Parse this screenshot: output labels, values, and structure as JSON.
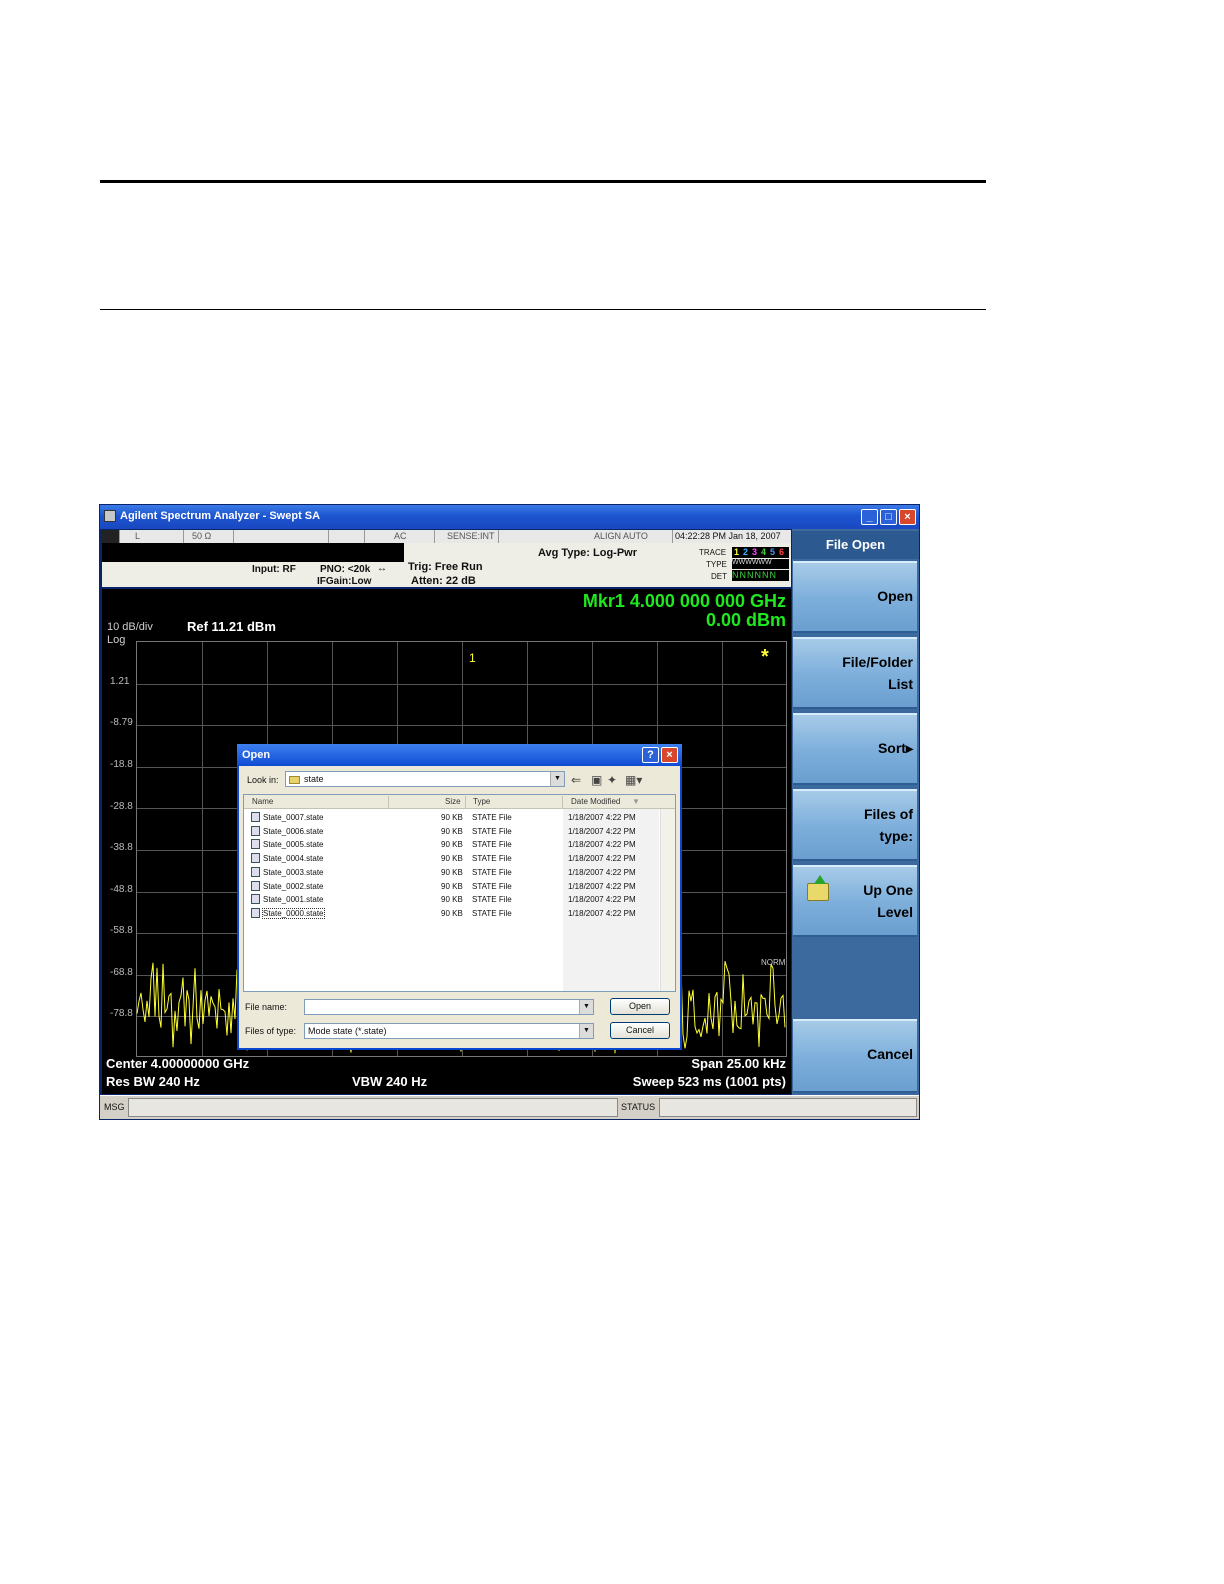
{
  "window": {
    "title": "Agilent Spectrum Analyzer - Swept SA",
    "controls": [
      "_",
      "□",
      "×"
    ]
  },
  "status": {
    "rf": "L",
    "impedance": "50 Ω",
    "coupling": "AC",
    "sense": "SENSE:INT",
    "align": "ALIGN AUTO",
    "datetime": "04:22:28 PM Jan 18, 2007"
  },
  "header": {
    "input": "Input: RF",
    "pno": "PNO: <20k",
    "ifgain": "IFGain:Low",
    "trig": "Trig: Free Run",
    "atten": "Atten: 22 dB",
    "avg_type": "Avg Type: Log-Pwr",
    "trace_label": "TRACE",
    "type_label": "TYPE",
    "det_label": "DET",
    "trace_digits": [
      "1",
      "2",
      "3",
      "4",
      "5",
      "6"
    ],
    "type_string": "WWWWWW",
    "det_string": "NNNNNN"
  },
  "display": {
    "marker_freq": "Mkr1 4.000 000 000 GHz",
    "marker_amp": "0.00 dBm",
    "scale": "10 dB/div",
    "ref": "Ref 11.21 dBm",
    "log": "Log",
    "y_labels": [
      "1.21",
      "-8.79",
      "-18.8",
      "-28.8",
      "-38.8",
      "-48.8",
      "-58.8",
      "-68.8",
      "-78.8"
    ],
    "center": "Center 4.00000000 GHz",
    "span": "Span 25.00 kHz",
    "res_bw": "Res BW 240 Hz",
    "vbw": "VBW 240 Hz",
    "sweep": "Sweep  523 ms (1001 pts)",
    "norm": "NORM",
    "marker_star": "*",
    "marker_number": "1"
  },
  "msgbar": {
    "msg": "MSG",
    "status": "STATUS"
  },
  "softkeys": {
    "title": "File Open",
    "open": "Open",
    "file_folder_line1": "File/Folder",
    "file_folder_line2": "List",
    "sort": "Sort▸",
    "files_of_type_line1": "Files of",
    "files_of_type_line2": "type:",
    "up_one_line1": "Up One",
    "up_one_line2": "Level",
    "cancel": "Cancel"
  },
  "dialog": {
    "title": "Open",
    "help": "?",
    "close": "×",
    "look_in_label": "Look in:",
    "look_in_value": "state",
    "columns": [
      "Name",
      "Size",
      "Type",
      "Date Modified"
    ],
    "files": [
      {
        "name": "State_0007.state",
        "size": "90 KB",
        "type": "STATE File",
        "date": "1/18/2007 4:22 PM"
      },
      {
        "name": "State_0006.state",
        "size": "90 KB",
        "type": "STATE File",
        "date": "1/18/2007 4:22 PM"
      },
      {
        "name": "State_0005.state",
        "size": "90 KB",
        "type": "STATE File",
        "date": "1/18/2007 4:22 PM"
      },
      {
        "name": "State_0004.state",
        "size": "90 KB",
        "type": "STATE File",
        "date": "1/18/2007 4:22 PM"
      },
      {
        "name": "State_0003.state",
        "size": "90 KB",
        "type": "STATE File",
        "date": "1/18/2007 4:22 PM"
      },
      {
        "name": "State_0002.state",
        "size": "90 KB",
        "type": "STATE File",
        "date": "1/18/2007 4:22 PM"
      },
      {
        "name": "State_0001.state",
        "size": "90 KB",
        "type": "STATE File",
        "date": "1/18/2007 4:22 PM"
      },
      {
        "name": "State_0000.state",
        "size": "90 KB",
        "type": "STATE File",
        "date": "1/18/2007 4:22 PM"
      }
    ],
    "file_name_label": "File name:",
    "file_name_value": "",
    "files_of_type_label": "Files of type:",
    "files_of_type_value": "Mode state (*.state)",
    "open_button": "Open",
    "cancel_button": "Cancel"
  },
  "colors": {
    "marker_green": "#1fe81f",
    "trace_yellow": "#ffff33",
    "softkey_blue": "#7fb0dc",
    "titlebar_blue": "#1d55d0"
  }
}
